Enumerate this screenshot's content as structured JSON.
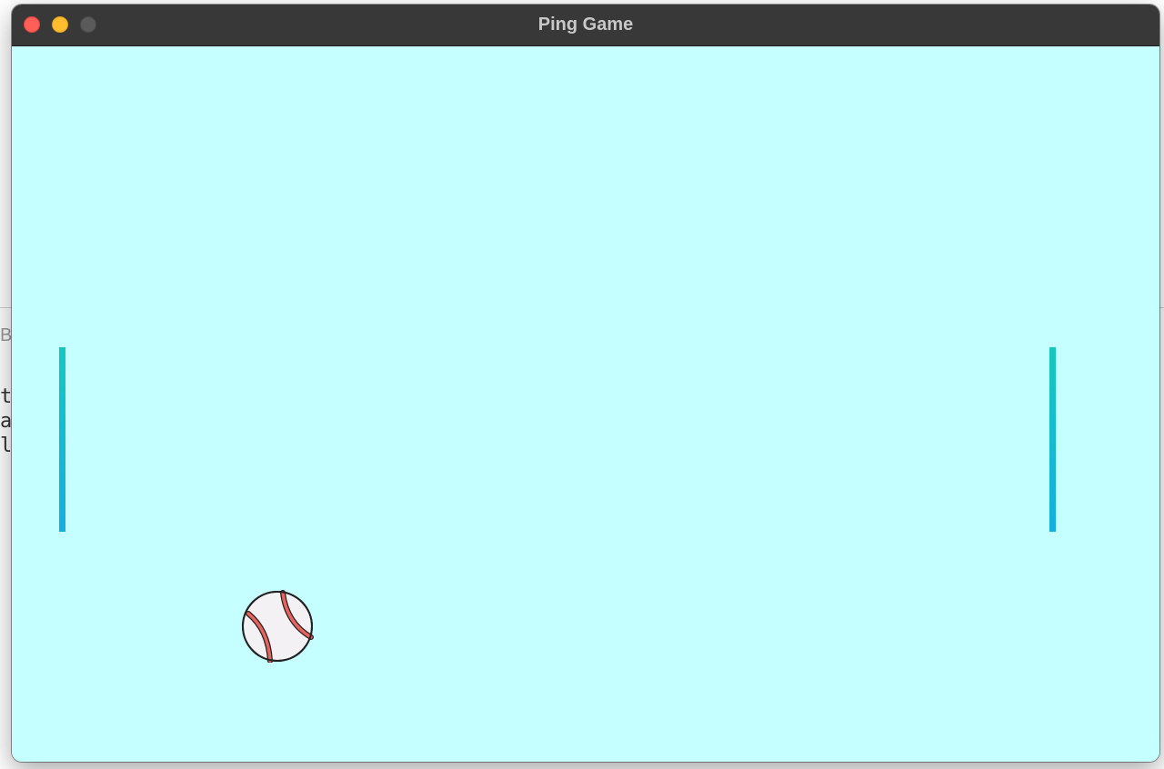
{
  "window": {
    "title": "Ping Game"
  },
  "background_editor": {
    "tab_fragment": "B",
    "code_fragments": [
      "t",
      "a",
      "l"
    ]
  },
  "game": {
    "left_paddle": {
      "color": "#14c8c0"
    },
    "right_paddle": {
      "color": "#14c8c0"
    },
    "ball": {
      "icon": "baseball-icon",
      "stitch_color": "#e0443e"
    },
    "background_color": "#c5ffff"
  }
}
